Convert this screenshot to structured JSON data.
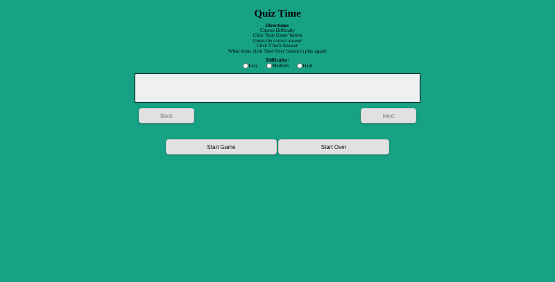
{
  "title": "Quiz Time",
  "directions": {
    "heading": "Directions:",
    "steps": [
      "Choose Difficulty",
      "Click 'Start Game' button",
      "Guess the correct answer",
      "Click 'Check Answer'",
      "When done, click 'Start Over' button to play again!"
    ]
  },
  "difficulty": {
    "heading": "Difficulty:",
    "options": [
      "Easy",
      "Medium",
      "Hard"
    ]
  },
  "question": {
    "text": ""
  },
  "navigation": {
    "back_label": "Back",
    "next_label": "Next"
  },
  "controls": {
    "start_label": "Start Game",
    "over_label": "Start Over"
  },
  "colors": {
    "background": "#17a286",
    "button": "#e1e1e1",
    "question_box": "#eef0f2"
  }
}
